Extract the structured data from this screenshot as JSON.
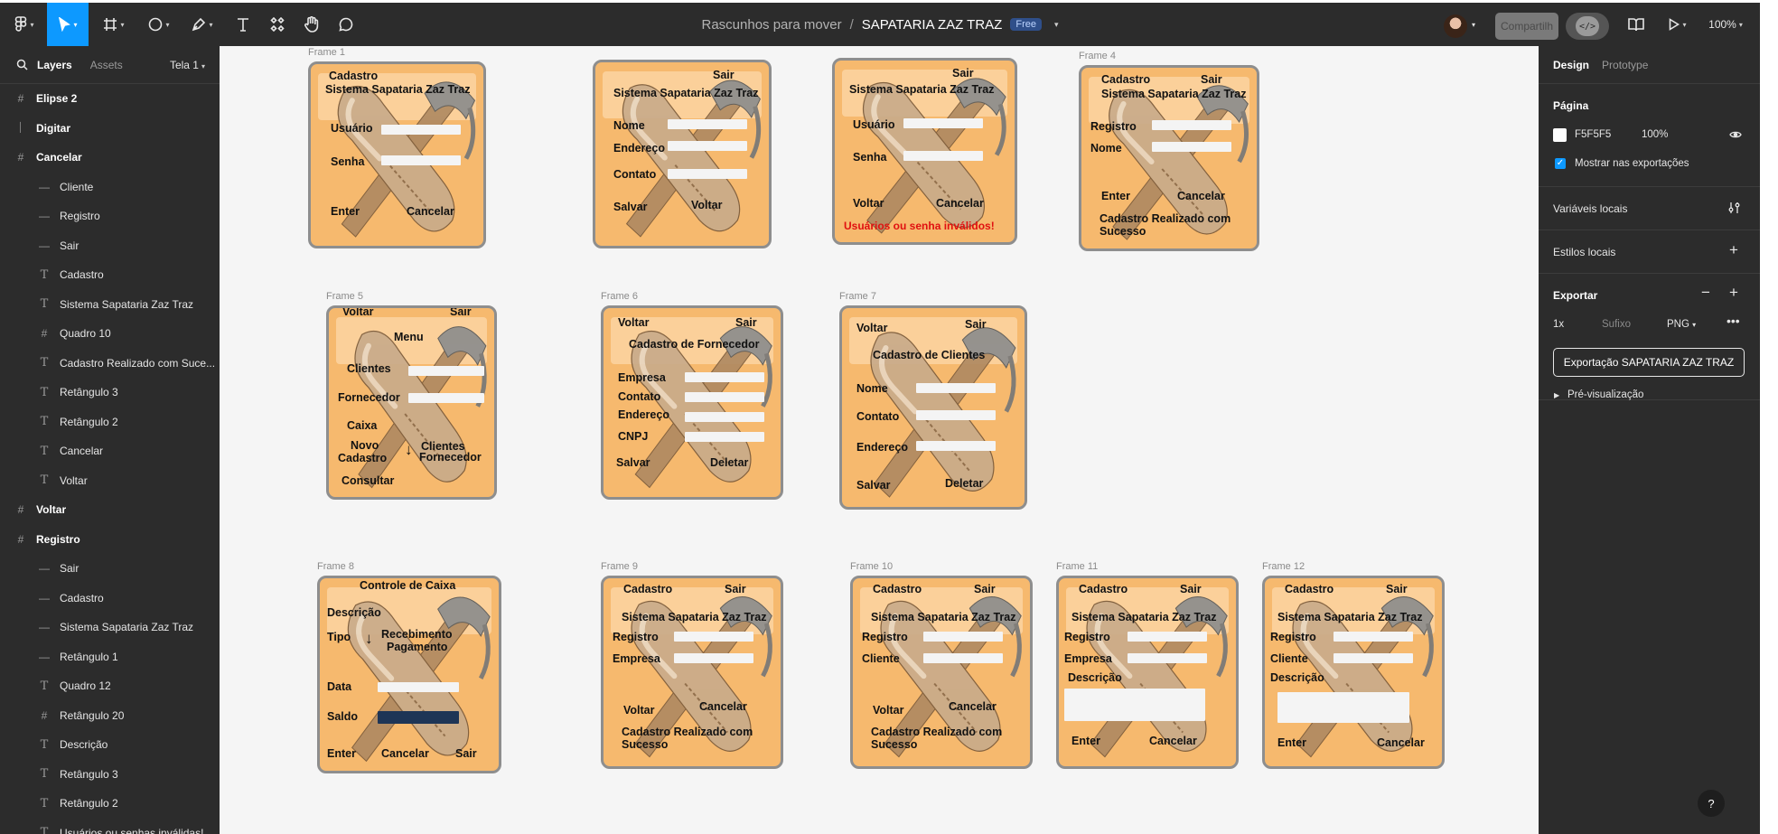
{
  "toolbar": {
    "zoom": "100%",
    "share_label": "Compartilh",
    "dev_mode_label": "</>",
    "project": "Rascunhos para mover",
    "separator": "/",
    "file_name": "SAPATARIA ZAZ TRAZ",
    "plan_badge": "Free",
    "icons": [
      "main-menu-icon",
      "move-tool-icon",
      "frame-tool-icon",
      "shape-tool-icon",
      "pen-tool-icon",
      "text-tool-icon",
      "components-icon",
      "hand-tool-icon",
      "comment-icon",
      "book-icon",
      "play-icon"
    ]
  },
  "left_panel": {
    "tabs": {
      "layers": "Layers",
      "assets": "Assets"
    },
    "page": "Tela 1",
    "layers": [
      {
        "label": "Elipse 2",
        "type": "frame",
        "level": 0
      },
      {
        "label": "Digitar",
        "type": "line",
        "level": 0
      },
      {
        "label": "Cancelar",
        "type": "frame",
        "level": 0
      },
      {
        "label": "Cliente",
        "type": "rect",
        "level": 1
      },
      {
        "label": "Registro",
        "type": "rect",
        "level": 1
      },
      {
        "label": "Sair",
        "type": "rect",
        "level": 1
      },
      {
        "label": "Cadastro",
        "type": "text",
        "level": 1
      },
      {
        "label": "Sistema Sapataria Zaz Traz",
        "type": "text",
        "level": 1
      },
      {
        "label": "Quadro 10",
        "type": "frame",
        "level": 1
      },
      {
        "label": "Cadastro Realizado com Suce...",
        "type": "text",
        "level": 1
      },
      {
        "label": "Retângulo 3",
        "type": "text",
        "level": 1
      },
      {
        "label": "Retângulo 2",
        "type": "text",
        "level": 1
      },
      {
        "label": "Cancelar",
        "type": "text",
        "level": 1
      },
      {
        "label": "Voltar",
        "type": "text",
        "level": 1
      },
      {
        "label": "Voltar",
        "type": "frame",
        "level": 0
      },
      {
        "label": "Registro",
        "type": "frame",
        "level": 0
      },
      {
        "label": "Sair",
        "type": "rect",
        "level": 1
      },
      {
        "label": "Cadastro",
        "type": "rect",
        "level": 1
      },
      {
        "label": "Sistema Sapataria Zaz Traz",
        "type": "rect",
        "level": 1
      },
      {
        "label": "Retângulo 1",
        "type": "rect",
        "level": 1
      },
      {
        "label": "Quadro 12",
        "type": "text",
        "level": 1
      },
      {
        "label": "Retângulo 20",
        "type": "frame",
        "level": 1
      },
      {
        "label": "Descrição",
        "type": "text",
        "level": 1
      },
      {
        "label": "Retângulo 3",
        "type": "text",
        "level": 1
      },
      {
        "label": "Retângulo 2",
        "type": "text",
        "level": 1
      },
      {
        "label": "Usuários ou senhas inválidas!",
        "type": "text",
        "level": 1
      }
    ]
  },
  "canvas": {
    "frame_labels": [
      "Frame 1",
      "Frame 4",
      "Frame 5",
      "Frame 6",
      "Frame 7",
      "Frame 8",
      "Frame 9",
      "Frame 10",
      "Frame 11",
      "Frame 12"
    ],
    "texts": {
      "cadastro": "Cadastro",
      "sair": "Sair",
      "sistema": "Sistema Sapataria Zaz Traz",
      "usuario": "Usuário",
      "senha": "Senha",
      "enter": "Enter",
      "cancelar": "Cancelar",
      "nome": "Nome",
      "endereco": "Endereço",
      "contato": "Contato",
      "salvar": "Salvar",
      "voltar": "Voltar",
      "invalid": "Usuários ou senha inválidos!",
      "registro": "Registro",
      "cadastro_ok_1": "Cadastro Realizado com",
      "cadastro_ok_2": "Sucesso",
      "menu": "Menu",
      "clientes": "Clientes",
      "fornecedor": "Fornecedor",
      "caixa": "Caixa",
      "novo": "Novo",
      "consultar": "Consultar",
      "cad_fornecedor": "Cadastro de Fornecedor",
      "empresa": "Empresa",
      "cnpj": "CNPJ",
      "deletar": "Deletar",
      "cad_clientes": "Cadastro de Clientes",
      "controle_caixa": "Controle de Caixa",
      "descricao": "Descrição",
      "tipo": "Tipo",
      "recebimento": "Recebimento",
      "pagamento": "Pagamento",
      "data": "Data",
      "saldo": "Saldo",
      "cliente": "Cliente",
      "arrow": "↓"
    }
  },
  "right_panel": {
    "tabs": {
      "design": "Design",
      "prototype": "Prototype"
    },
    "page_section": "Página",
    "page_color": "F5F5F5",
    "page_opacity": "100%",
    "show_in_exports": "Mostrar nas exportações",
    "local_variables": "Variáveis locais",
    "local_styles": "Estilos locais",
    "export_section": "Exportar",
    "export_scale": "1x",
    "export_suffix_placeholder": "Sufixo",
    "export_format": "PNG",
    "export_button": "Exportação SAPATARIA ZAZ TRAZ",
    "preview": "Pré-visualização",
    "help": "?"
  },
  "colors": {
    "accent": "#0d99ff",
    "frame_fill": "#f6b96e",
    "error": "#e01010",
    "panel": "#2c2c2c",
    "canvas": "#f5f5f5"
  }
}
